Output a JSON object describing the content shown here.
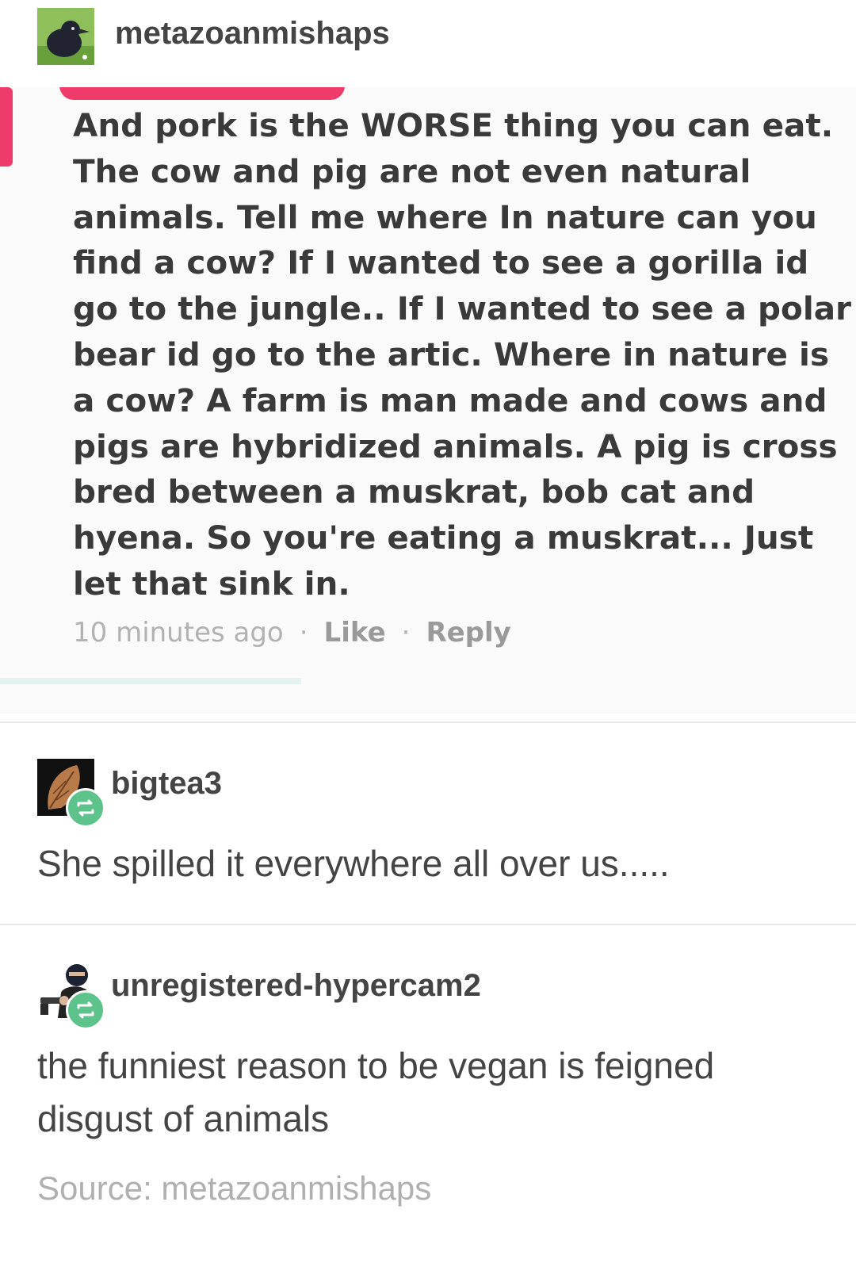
{
  "header": {
    "username": "metazoanmishaps"
  },
  "screenshot_comment": {
    "lines": [
      "And pork is the WORSE thing you can eat.",
      "The cow and pig are not even natural",
      "animals. Tell me where In nature can you",
      "find a cow? If I wanted to see a gorilla id",
      "go to the jungle.. If I wanted to see a polar",
      "bear id go to the artic. Where in nature is",
      "a cow? A farm is man made and cows and",
      "pigs are hybridized animals. A pig is cross",
      "bred between a muskrat, bob cat and",
      "hyena. So you're eating a muskrat... Just",
      "let that sink in."
    ],
    "timestamp": "10 minutes ago",
    "separator": "·",
    "like_label": "Like",
    "reply_label": "Reply"
  },
  "reblogs": [
    {
      "username": "bigtea3",
      "text": "She spilled it everywhere all over us....."
    },
    {
      "username": "unregistered-hypercam2",
      "text": "the funniest reason to be vegan is feigned disgust of animals"
    }
  ],
  "source": {
    "label": "Source: metazoanmishaps"
  },
  "icons": {
    "reblog_badge": "reblog-icon",
    "badge_color": "#5dc38a",
    "accent_pink": "#ef3b6a"
  }
}
